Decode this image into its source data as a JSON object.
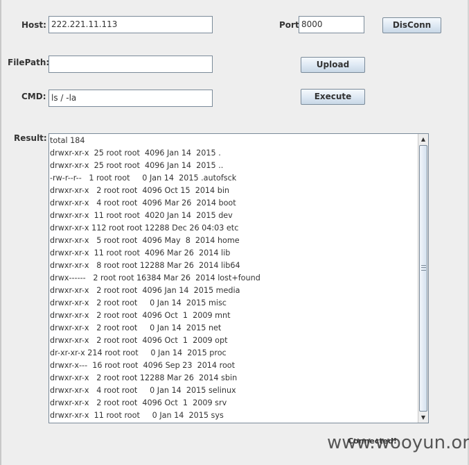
{
  "form": {
    "host_label": "Host:",
    "host_value": "222.221.11.113",
    "port_label": "Port:",
    "port_value": "8000",
    "filepath_label": "FilePath:",
    "filepath_value": "",
    "cmd_label": "CMD:",
    "cmd_value": "ls / -la",
    "result_label": "Result:"
  },
  "buttons": {
    "disconnect": "DisConn",
    "upload": "Upload",
    "execute": "Execute"
  },
  "result_lines": [
    "total 184",
    "drwxr-xr-x  25 root root  4096 Jan 14  2015 .",
    "drwxr-xr-x  25 root root  4096 Jan 14  2015 ..",
    "-rw-r--r--   1 root root     0 Jan 14  2015 .autofsck",
    "drwxr-xr-x   2 root root  4096 Oct 15  2014 bin",
    "drwxr-xr-x   4 root root  4096 Mar 26  2014 boot",
    "drwxr-xr-x  11 root root  4020 Jan 14  2015 dev",
    "drwxr-xr-x 112 root root 12288 Dec 26 04:03 etc",
    "drwxr-xr-x   5 root root  4096 May  8  2014 home",
    "drwxr-xr-x  11 root root  4096 Mar 26  2014 lib",
    "drwxr-xr-x   8 root root 12288 Mar 26  2014 lib64",
    "drwx------   2 root root 16384 Mar 26  2014 lost+found",
    "drwxr-xr-x   2 root root  4096 Jan 14  2015 media",
    "drwxr-xr-x   2 root root     0 Jan 14  2015 misc",
    "drwxr-xr-x   2 root root  4096 Oct  1  2009 mnt",
    "drwxr-xr-x   2 root root     0 Jan 14  2015 net",
    "drwxr-xr-x   2 root root  4096 Oct  1  2009 opt",
    "dr-xr-xr-x 214 root root     0 Jan 14  2015 proc",
    "drwxr-x---  16 root root  4096 Sep 23  2014 root",
    "drwxr-xr-x   2 root root 12288 Mar 26  2014 sbin",
    "drwxr-xr-x   4 root root     0 Jan 14  2015 selinux",
    "drwxr-xr-x   2 root root  4096 Oct  1  2009 srv",
    "drwxr-xr-x  11 root root     0 Jan 14  2015 sys"
  ],
  "status": "Connected!",
  "watermark": "www.wooyun.org",
  "icons": {
    "scroll_up": "scroll-up-arrow",
    "scroll_down": "scroll-down-arrow"
  }
}
